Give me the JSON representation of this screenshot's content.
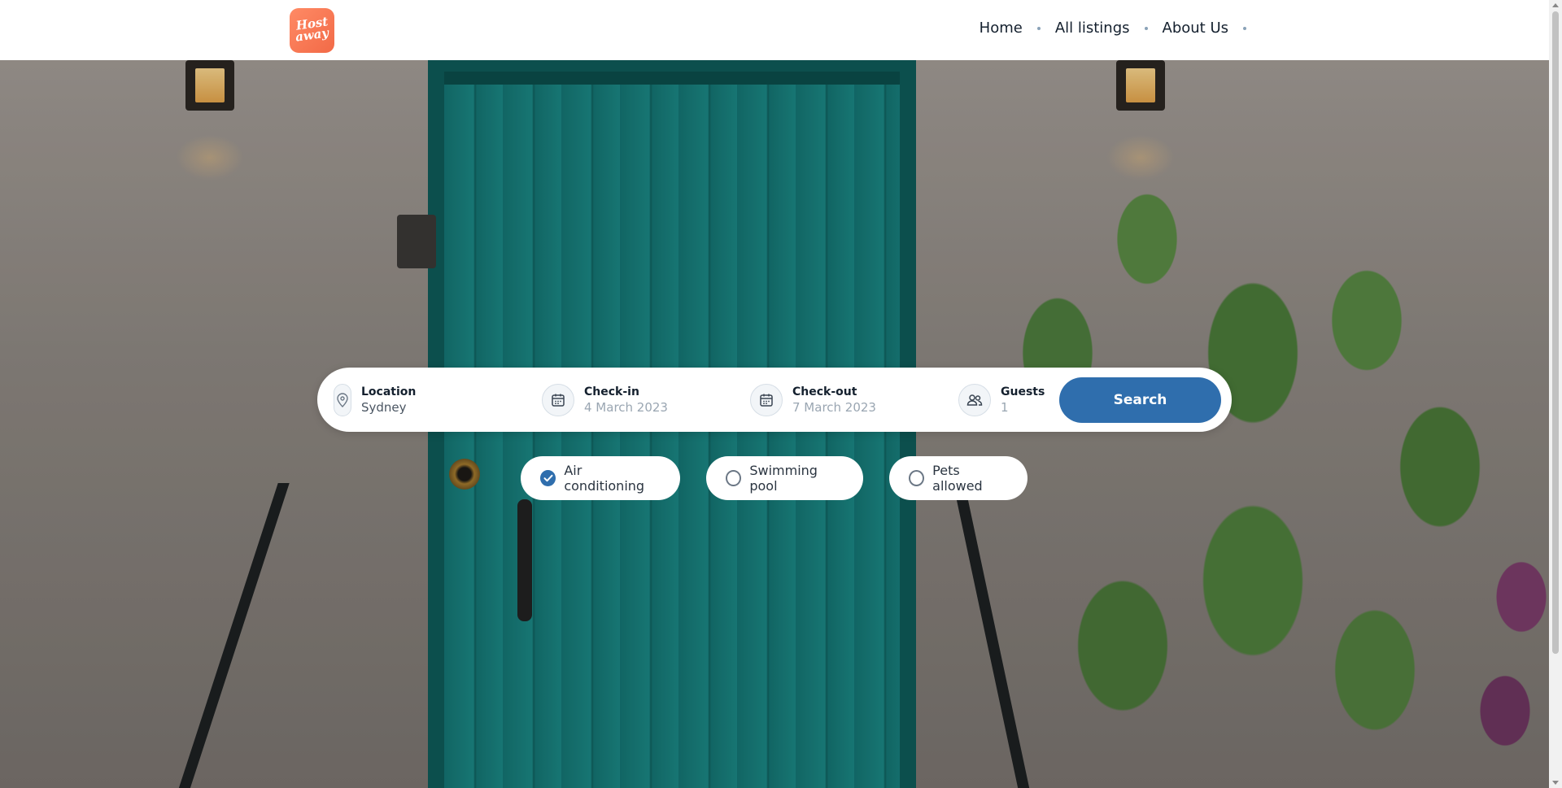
{
  "header": {
    "logo_text_line1": "Host",
    "logo_text_line2": "away",
    "nav": [
      {
        "label": "Home"
      },
      {
        "label": "All listings"
      },
      {
        "label": "About Us"
      }
    ]
  },
  "search": {
    "location": {
      "label": "Location",
      "value": "Sydney",
      "icon": "map-pin-icon"
    },
    "checkin": {
      "label": "Check-in",
      "placeholder": "4 March 2023",
      "icon": "calendar-icon"
    },
    "checkout": {
      "label": "Check-out",
      "placeholder": "7 March 2023",
      "icon": "calendar-icon"
    },
    "guests": {
      "label": "Guests",
      "placeholder": "1",
      "icon": "users-icon"
    },
    "button_label": "Search"
  },
  "filters": [
    {
      "label": "Air conditioning",
      "checked": true
    },
    {
      "label": "Swimming pool",
      "checked": false
    },
    {
      "label": "Pets allowed",
      "checked": false
    }
  ],
  "colors": {
    "accent": "#2f6ead",
    "logo": "#f26a47",
    "text": "#14202e"
  }
}
